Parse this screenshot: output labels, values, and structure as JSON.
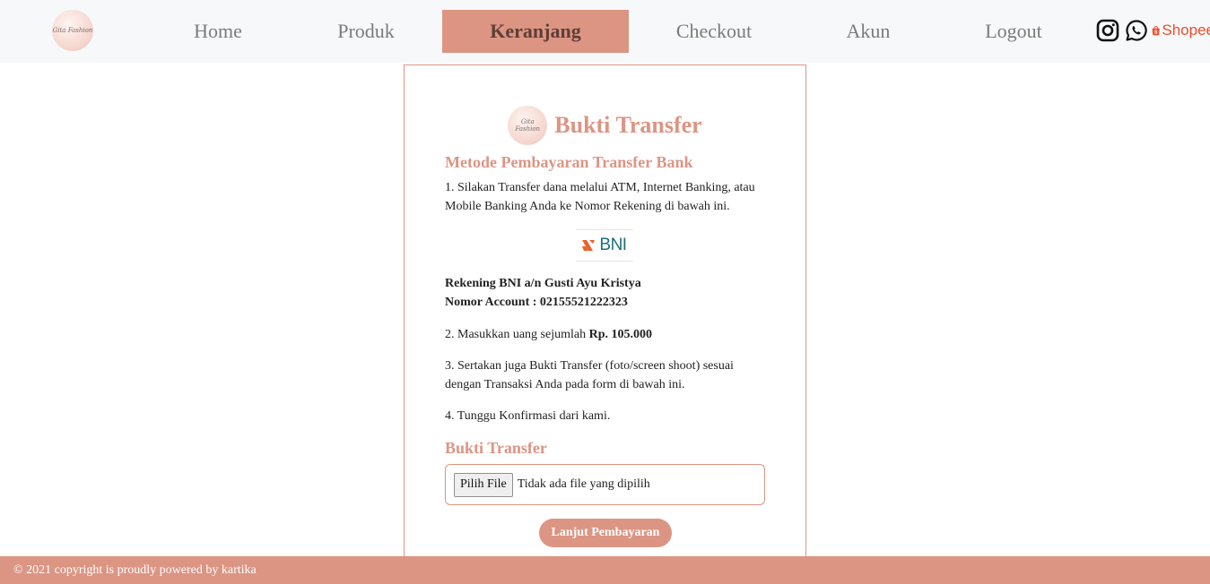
{
  "brand": {
    "logo_text": "Gita Fashion"
  },
  "nav": {
    "items": [
      {
        "label": "Home"
      },
      {
        "label": "Produk"
      },
      {
        "label": "Keranjang",
        "active": true
      },
      {
        "label": "Checkout"
      },
      {
        "label": "Akun"
      },
      {
        "label": "Logout"
      }
    ],
    "social": [
      {
        "name": "instagram-icon"
      },
      {
        "name": "whatsapp-icon"
      },
      {
        "name": "shopee-icon",
        "label": "Shopee"
      }
    ]
  },
  "card": {
    "title": "Bukti Transfer",
    "method_heading": "Metode Pembayaran Transfer Bank",
    "step1": "1. Silakan Transfer dana melalui ATM, Internet Banking, atau Mobile Banking Anda ke Nomor Rekening di bawah ini.",
    "bank_logo_text": "BNI",
    "account_name": "Rekening BNI a/n Gusti Ayu Kristya",
    "account_number": "Nomor Account : 02155521222323",
    "step2_prefix": "2. Masukkan uang sejumlah",
    "step2_amount": "Rp. 105.000",
    "step3": "3. Sertakan juga Bukti Transfer (foto/screen shoot) sesuai dengan Transaksi Anda pada form di bawah ini.",
    "step4": "4. Tunggu Konfirmasi dari kami.",
    "upload_heading": "Bukti Transfer",
    "file_button": "Pilih File",
    "file_status": "Tidak ada file yang dipilih",
    "submit_label": "Lanjut Pembayaran"
  },
  "footer": {
    "text": "© 2021 copyright is proudly powered by kartika"
  },
  "colors": {
    "accent": "#dc9583",
    "nav_bg": "#f7f8f9",
    "bni_teal": "#1b6e77",
    "bni_orange": "#e8622c",
    "shopee": "#ee4d2d"
  }
}
